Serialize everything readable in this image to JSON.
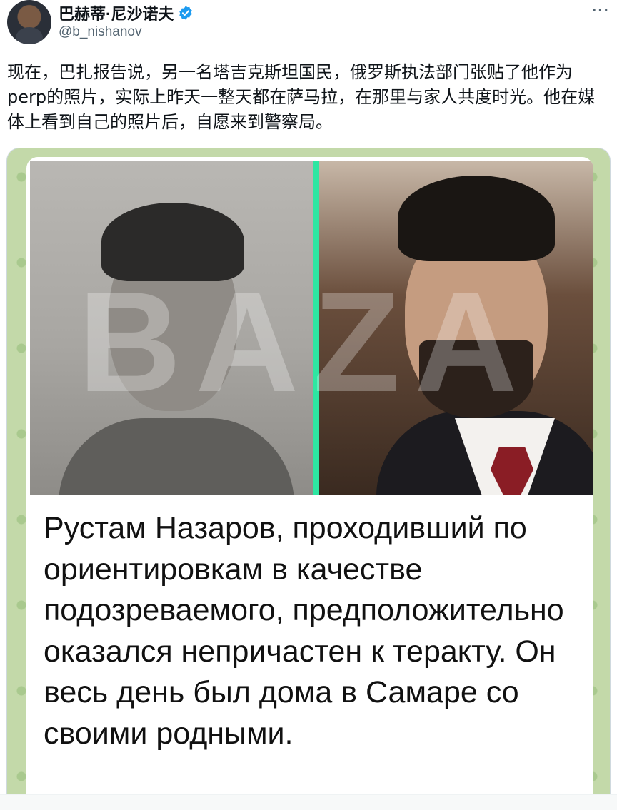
{
  "author": {
    "display_name": "巴赫蒂·尼沙诺夫",
    "handle": "@b_nishanov",
    "verified_icon": "verified-badge-icon",
    "more_label": "···"
  },
  "tweet": {
    "text": "现在，巴扎报告说，另一名塔吉克斯坦国民，俄罗斯执法部门张贴了他作为perp的照片，实际上昨天一整天都在萨马拉，在那里与家人共度时光。他在媒体上看到自己的照片后，自愿来到警察局。"
  },
  "media": {
    "watermark": "BAZA",
    "caption": "Рустам Назаров, проходивший по ориентировкам в качестве подозреваемого, предположительно оказался непричастен к теракту. Он весь день был дома в Самаре со своими родными.",
    "divider_color": "#2ee6a2",
    "background_color": "#c3d9a9"
  },
  "colors": {
    "verified": "#1d9bf0",
    "text": "#0f1419",
    "secondary": "#536471"
  }
}
